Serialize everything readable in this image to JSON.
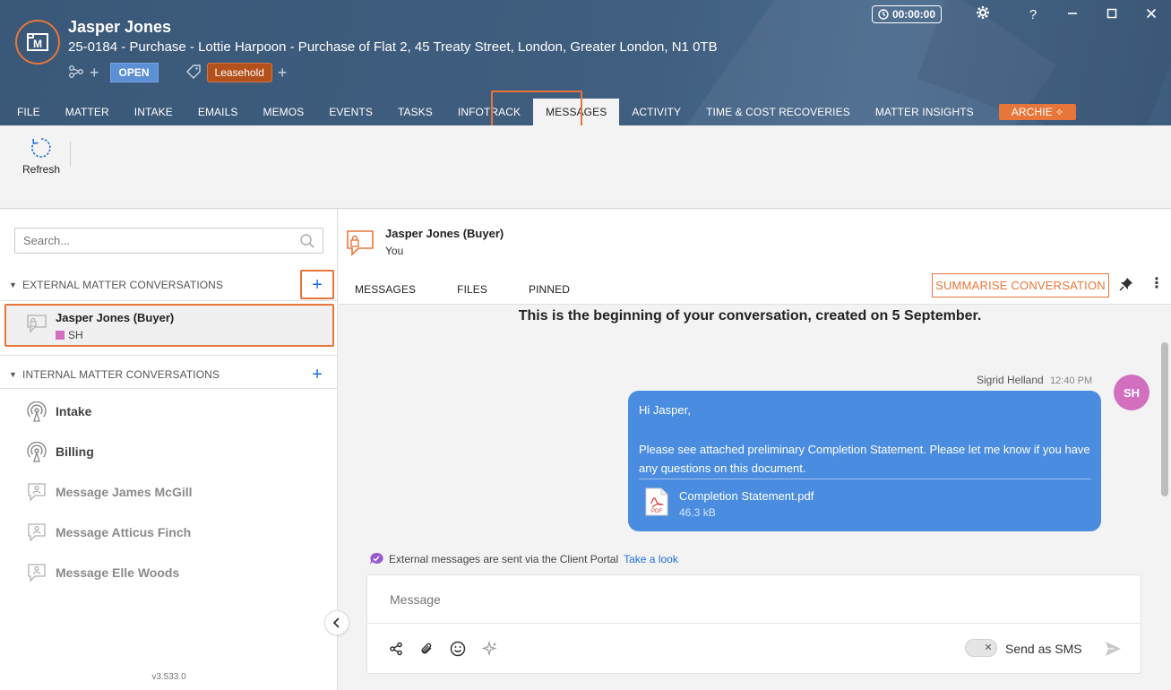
{
  "header": {
    "client_name": "Jasper Jones",
    "matter_description": "25-0184 - Purchase - Lottie Harpoon - Purchase of Flat 2, 45 Treaty Street, London, Greater London, N1 0TB",
    "status_badge": "OPEN",
    "tag_label": "Leasehold",
    "timer": "00:00:00",
    "help": "?",
    "accent_color": "#e8763a"
  },
  "tabs": [
    {
      "label": "FILE"
    },
    {
      "label": "MATTER"
    },
    {
      "label": "INTAKE"
    },
    {
      "label": "EMAILS"
    },
    {
      "label": "MEMOS"
    },
    {
      "label": "EVENTS"
    },
    {
      "label": "TASKS"
    },
    {
      "label": "INFOTRACK"
    },
    {
      "label": "MESSAGES",
      "active": true
    },
    {
      "label": "ACTIVITY"
    },
    {
      "label": "TIME & COST RECOVERIES"
    },
    {
      "label": "MATTER INSIGHTS"
    },
    {
      "label": "ARCHIE"
    }
  ],
  "ribbon": {
    "refresh_label": "Refresh"
  },
  "left": {
    "search_placeholder": "Search...",
    "external_header": "EXTERNAL MATTER CONVERSATIONS",
    "external_item": {
      "name": "Jasper Jones (Buyer)",
      "initials": "SH"
    },
    "internal_header": "INTERNAL MATTER CONVERSATIONS",
    "internal_items": [
      {
        "label": "Intake"
      },
      {
        "label": "Billing"
      },
      {
        "label": "Message James McGill"
      },
      {
        "label": "Message Atticus Finch"
      },
      {
        "label": "Message Elle Woods"
      }
    ],
    "version": "v3.533.0"
  },
  "conversation": {
    "title": "Jasper Jones (Buyer)",
    "subtitle": "You",
    "tabs": [
      "MESSAGES",
      "FILES",
      "PINNED"
    ],
    "summarise_label": "SUMMARISE CONVERSATION",
    "beginning_prefix": "This is the beginning of your conversation, created on ",
    "beginning_date": "5 September",
    "beginning_suffix": ".",
    "message": {
      "sender": "Sigrid Helland",
      "time": "12:40 PM",
      "avatar_initials": "SH",
      "greeting": "Hi Jasper,",
      "body": "Please see attached preliminary Completion Statement. Please let me know if you have any questions on this document.",
      "attachment_name": "Completion Statement.pdf",
      "attachment_size": "46.3 kB"
    },
    "portal_note": "External messages are sent via the Client Portal",
    "portal_link": "Take a look",
    "composer_placeholder": "Message",
    "sms_label": "Send as SMS"
  }
}
